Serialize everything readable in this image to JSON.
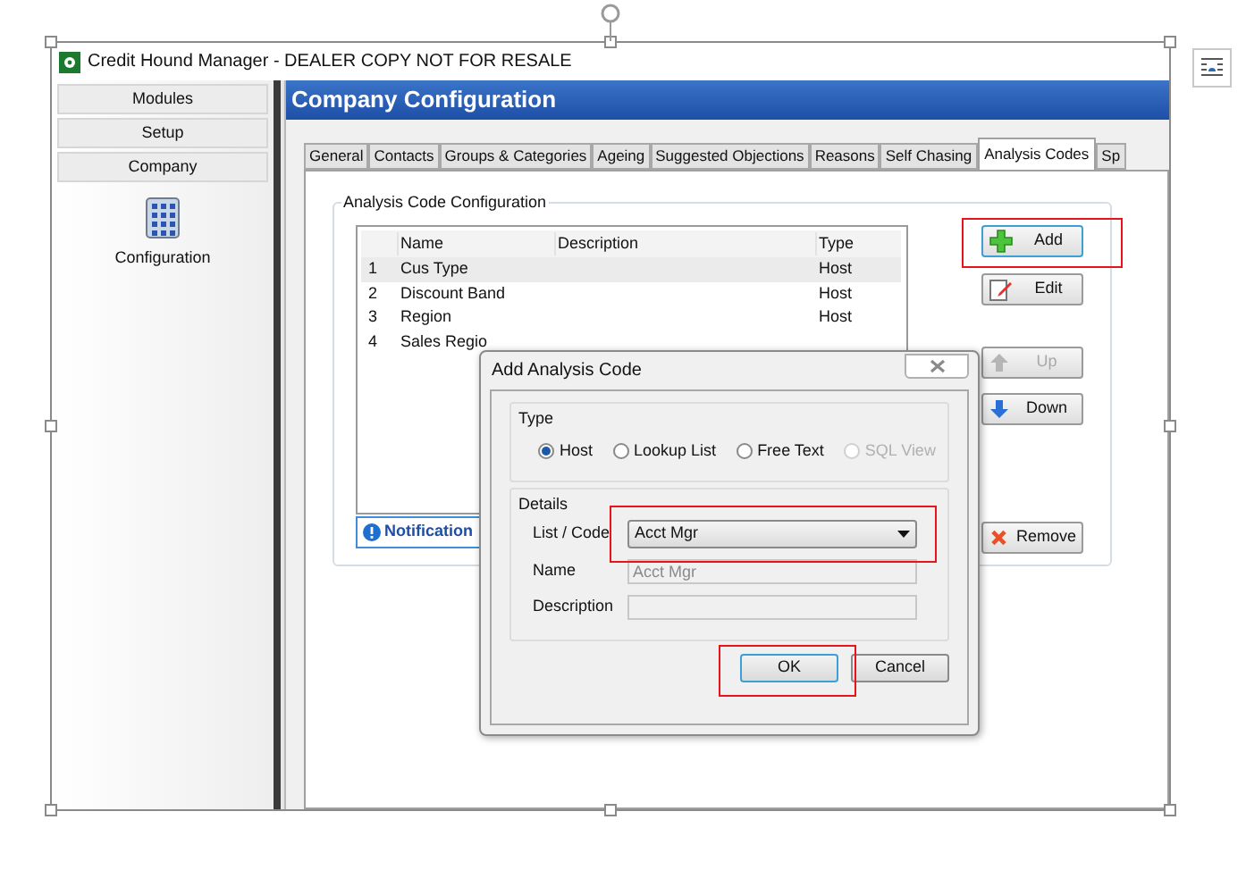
{
  "window": {
    "title": "Credit Hound Manager - DEALER COPY NOT FOR RESALE"
  },
  "sidebar": {
    "sections": [
      {
        "label": "Modules"
      },
      {
        "label": "Setup"
      },
      {
        "label": "Company"
      }
    ],
    "items": [
      {
        "label": "Configuration"
      }
    ]
  },
  "header": {
    "title": "Company Configuration"
  },
  "tabs": [
    {
      "label": "General",
      "selected": false
    },
    {
      "label": "Contacts",
      "selected": false
    },
    {
      "label": "Groups & Categories",
      "selected": false
    },
    {
      "label": "Ageing",
      "selected": false
    },
    {
      "label": "Suggested Objections",
      "selected": false
    },
    {
      "label": "Reasons",
      "selected": false
    },
    {
      "label": "Self Chasing",
      "selected": false
    },
    {
      "label": "Analysis Codes",
      "selected": true
    },
    {
      "label": "Sp",
      "selected": false
    }
  ],
  "group": {
    "title": "Analysis Code Configuration"
  },
  "table": {
    "columns": [
      "Name",
      "Description",
      "Type"
    ],
    "rows": [
      {
        "index": "1",
        "name": "Cus Type",
        "type": "Host",
        "selected": true
      },
      {
        "index": "2",
        "name": "Discount Band",
        "type": "Host",
        "selected": false
      },
      {
        "index": "3",
        "name": "Region",
        "type": "Host",
        "selected": false
      },
      {
        "index": "4",
        "name": "Sales Regio",
        "selected": false
      }
    ]
  },
  "notification": {
    "label": "Notification"
  },
  "buttons": [
    {
      "kind": "add",
      "label": "Add",
      "disabled": false,
      "highlighted": true
    },
    {
      "kind": "edit",
      "label": "Edit",
      "disabled": false,
      "highlighted": false
    },
    {
      "kind": "up",
      "label": "Up",
      "disabled": true,
      "highlighted": false
    },
    {
      "kind": "down",
      "label": "Down",
      "disabled": false,
      "highlighted": false
    },
    {
      "kind": "remove",
      "label": "Remove",
      "disabled": false,
      "highlighted": false
    }
  ],
  "dialog": {
    "title": "Add Analysis Code",
    "type_group": "Type",
    "types": [
      {
        "label": "Host",
        "selected": true,
        "disabled": false
      },
      {
        "label": "Lookup List",
        "selected": false,
        "disabled": false
      },
      {
        "label": "Free Text",
        "selected": false,
        "disabled": false
      },
      {
        "label": "SQL View",
        "selected": false,
        "disabled": true
      }
    ],
    "details_group": "Details",
    "list_label": "List / Code",
    "list_value": "Acct Mgr",
    "list_highlighted": true,
    "name_label": "Name",
    "name_value": "Acct Mgr",
    "description_label": "Description",
    "ok": {
      "label": "OK",
      "highlighted": true
    },
    "cancel": {
      "label": "Cancel"
    }
  }
}
